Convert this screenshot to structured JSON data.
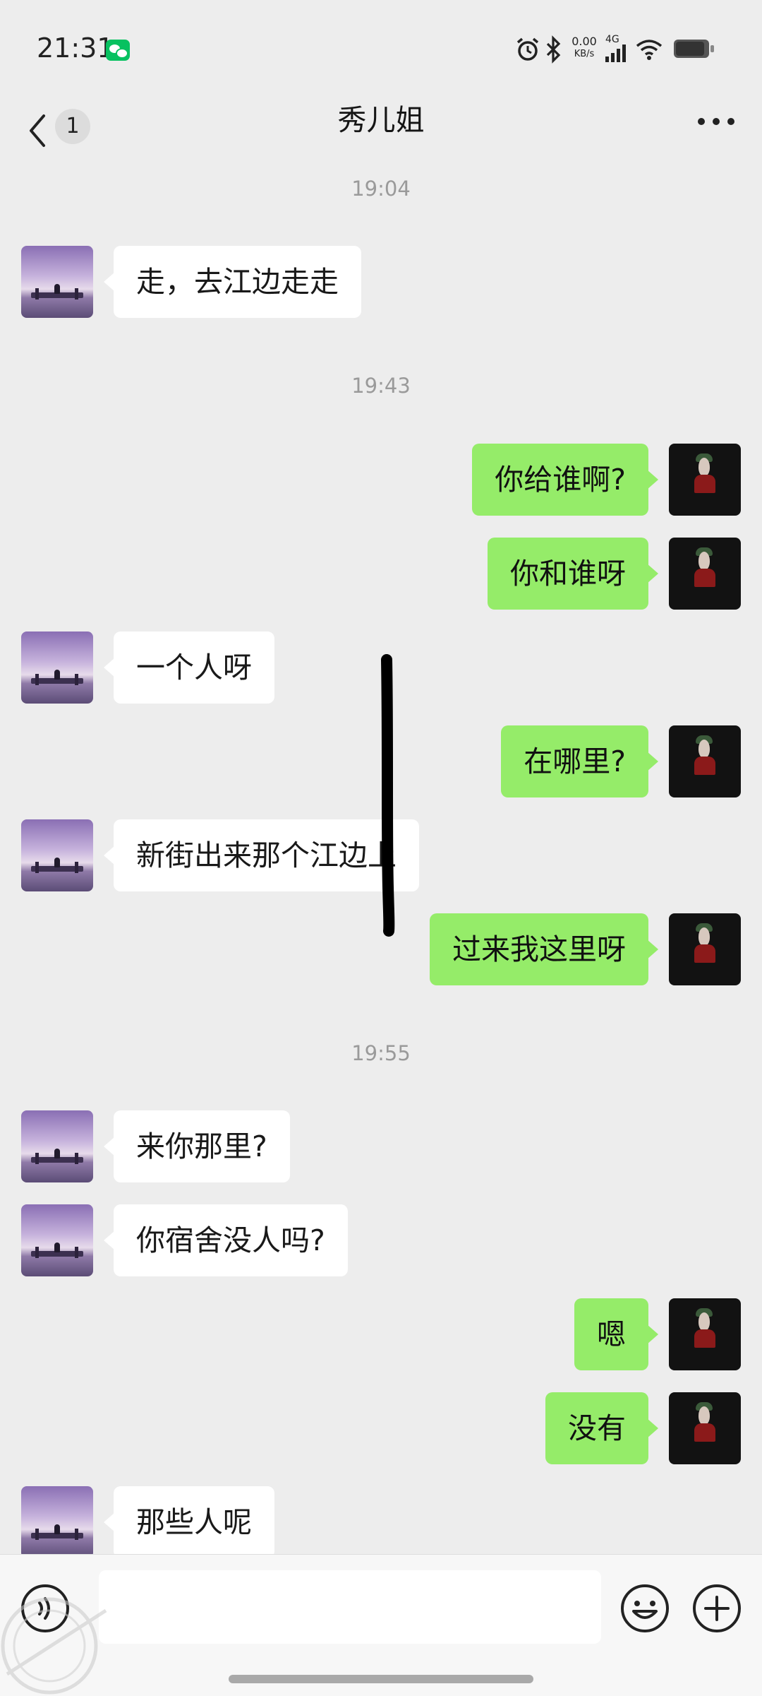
{
  "status_bar": {
    "time": "21:31",
    "notification_icon": "wechat-icon",
    "icons": [
      "alarm-icon",
      "bluetooth-icon",
      "network-speed",
      "signal-icon",
      "wifi-icon",
      "battery-icon"
    ],
    "network_speed_value": "0.00",
    "network_speed_unit": "KB/s",
    "network_type": "4G"
  },
  "header": {
    "back_icon": "chevron-left-icon",
    "unread_count": "1",
    "title": "秀儿姐",
    "more_icon": "more-icon"
  },
  "chat": {
    "timestamps": [
      "19:04",
      "19:43",
      "19:55"
    ],
    "messages": [
      {
        "side": "left",
        "text": "走，去江边走走"
      },
      {
        "side": "right",
        "text": "你给谁啊?"
      },
      {
        "side": "right",
        "text": "你和谁呀"
      },
      {
        "side": "left",
        "text": "一个人呀"
      },
      {
        "side": "right",
        "text": "在哪里?"
      },
      {
        "side": "left",
        "text": "新街出来那个江边上"
      },
      {
        "side": "right",
        "text": "过来我这里呀"
      },
      {
        "side": "left",
        "text": "来你那里?"
      },
      {
        "side": "left",
        "text": "你宿舍没人吗?"
      },
      {
        "side": "right",
        "text": "嗯"
      },
      {
        "side": "right",
        "text": "没有"
      },
      {
        "side": "left",
        "text": "那些人呢"
      }
    ]
  },
  "input_bar": {
    "voice_icon": "voice-icon",
    "input_value": "",
    "emoji_icon": "emoji-icon",
    "plus_icon": "plus-icon"
  },
  "colors": {
    "background": "#ededed",
    "outgoing_bubble": "#95ec69",
    "incoming_bubble": "#ffffff",
    "brand": "#07c160"
  }
}
